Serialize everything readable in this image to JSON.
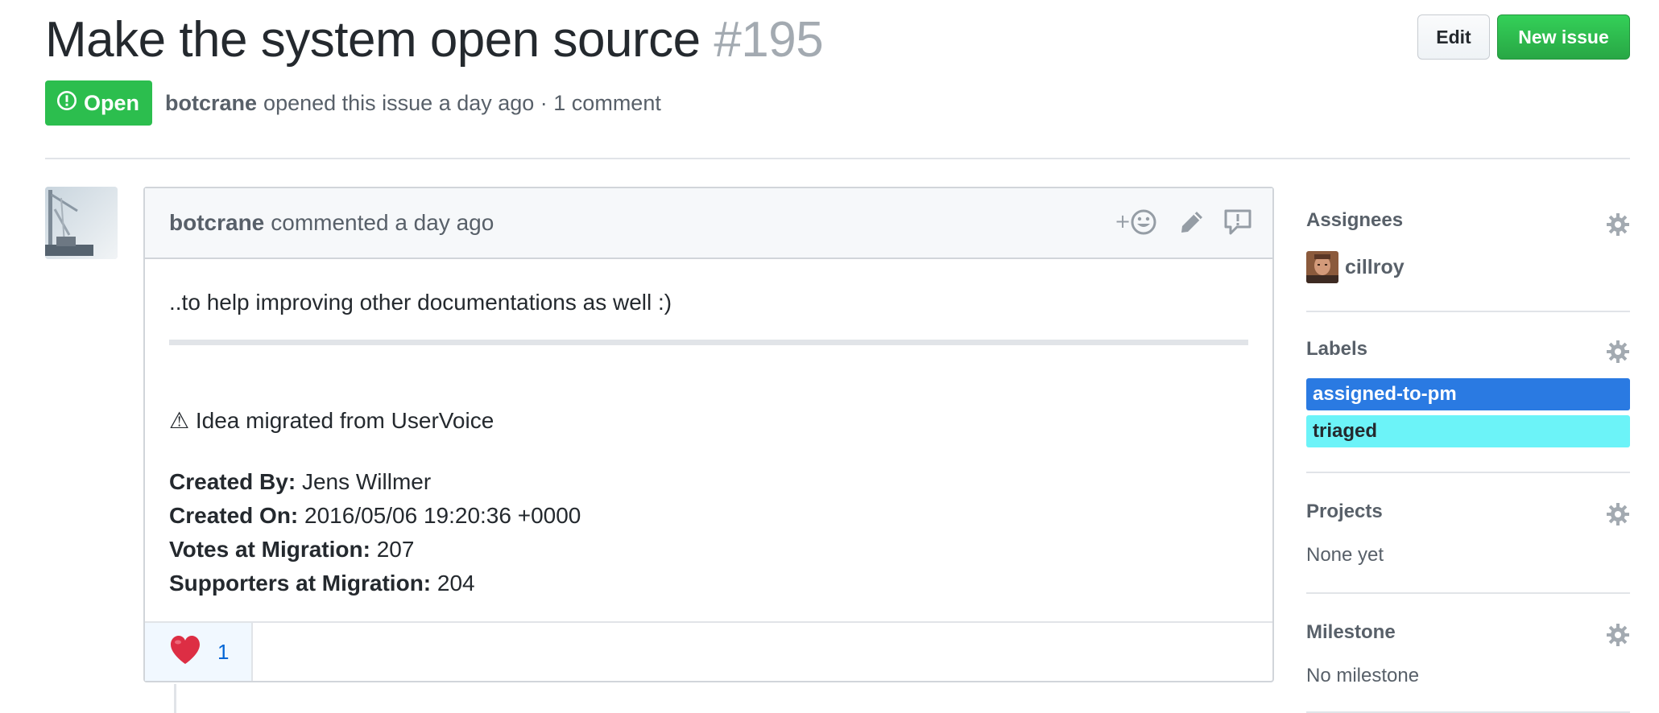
{
  "issue": {
    "title": "Make the system open source",
    "number": "#195",
    "state": "Open",
    "author": "botcrane",
    "opened_text": "opened this issue a day ago · 1 comment"
  },
  "actions": {
    "edit_label": "Edit",
    "new_issue_label": "New issue"
  },
  "comment": {
    "author": "botcrane",
    "meta_text": "commented a day ago",
    "body_line1": "..to help improving other documentations as well :)",
    "migration_note": "⚠ Idea migrated from UserVoice",
    "fields": [
      {
        "label": "Created By:",
        "value": "Jens Willmer"
      },
      {
        "label": "Created On:",
        "value": "2016/05/06 19:20:36 +0000"
      },
      {
        "label": "Votes at Migration:",
        "value": "207"
      },
      {
        "label": "Supporters at Migration:",
        "value": "204"
      }
    ],
    "reaction": {
      "emoji": "heart-emoji",
      "count": "1"
    }
  },
  "sidebar": {
    "assignees": {
      "title": "Assignees",
      "items": [
        {
          "name": "cillroy"
        }
      ]
    },
    "labels": {
      "title": "Labels",
      "items": [
        {
          "name": "assigned-to-pm",
          "color": "#2a7ae2",
          "text_color": "#ffffff"
        },
        {
          "name": "triaged",
          "color": "#6cf3f8",
          "text_color": "#24292e"
        }
      ]
    },
    "projects": {
      "title": "Projects",
      "value": "None yet"
    },
    "milestone": {
      "title": "Milestone",
      "value": "No milestone"
    }
  },
  "colors": {
    "open_green": "#2cbe4e",
    "button_green": "#28a745",
    "link_blue": "#0366d6",
    "muted": "#586069"
  },
  "icons": [
    "issue-opened-icon",
    "add-reaction-icon",
    "pencil-icon",
    "report-icon",
    "gear-icon"
  ]
}
